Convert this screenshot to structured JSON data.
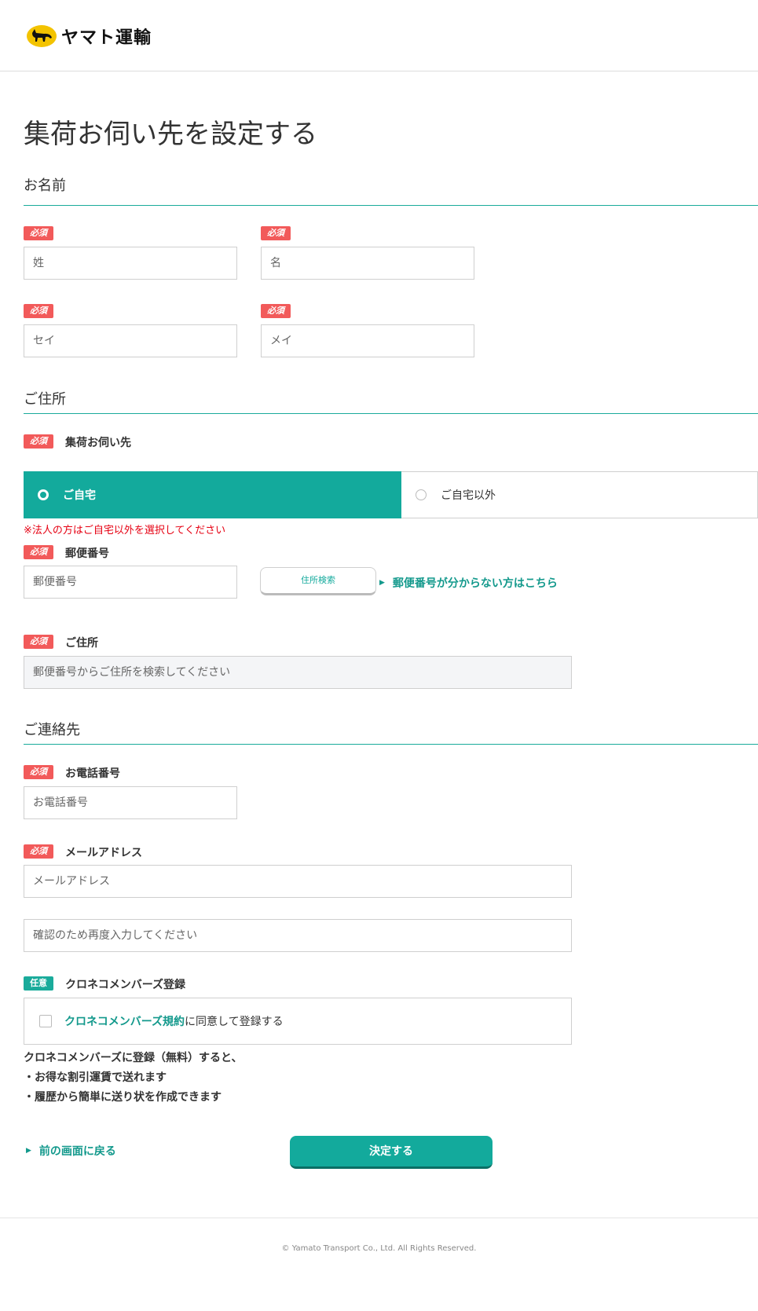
{
  "header": {
    "logo_text": "ヤマト運輸"
  },
  "page_title": "集荷お伺い先を設定する",
  "sections": {
    "name": "お名前",
    "address": "ご住所",
    "contact": "ご連絡先"
  },
  "badges": {
    "required": "必須",
    "optional": "任意"
  },
  "name_fields": {
    "last_name_placeholder": "姓",
    "first_name_placeholder": "名",
    "last_kana_placeholder": "セイ",
    "first_kana_placeholder": "メイ"
  },
  "pickup": {
    "label": "集荷お伺い先",
    "options": [
      "ご自宅",
      "ご自宅以外"
    ],
    "selected": "ご自宅",
    "note": "※法人の方はご自宅以外を選択してください"
  },
  "postal": {
    "label": "郵便番号",
    "placeholder": "郵便番号",
    "search_button": "住所検索",
    "help_link": "郵便番号が分からない方はこちら"
  },
  "address": {
    "label": "ご住所",
    "placeholder": "郵便番号からご住所を検索してください"
  },
  "phone": {
    "label": "お電話番号",
    "placeholder": "お電話番号"
  },
  "email": {
    "label": "メールアドレス",
    "placeholder": "メールアドレス",
    "confirm_placeholder": "確認のため再度入力してください"
  },
  "membership": {
    "label": "クロネコメンバーズ登録",
    "terms_link": "クロネコメンバーズ規約",
    "checkbox_text": "に同意して登録する",
    "benefits_intro": "クロネコメンバーズに登録（無料）すると、",
    "benefits": [
      "・お得な割引運賃で送れます",
      "・履歴から簡単に送り状を作成できます"
    ]
  },
  "actions": {
    "back_link": "前の画面に戻る",
    "submit": "決定する"
  },
  "footer": {
    "copyright": "© Yamato Transport Co., Ltd. All Rights Reserved."
  },
  "colors": {
    "accent": "#13aa9c",
    "required": "#f25a5a",
    "error": "#e60012"
  }
}
